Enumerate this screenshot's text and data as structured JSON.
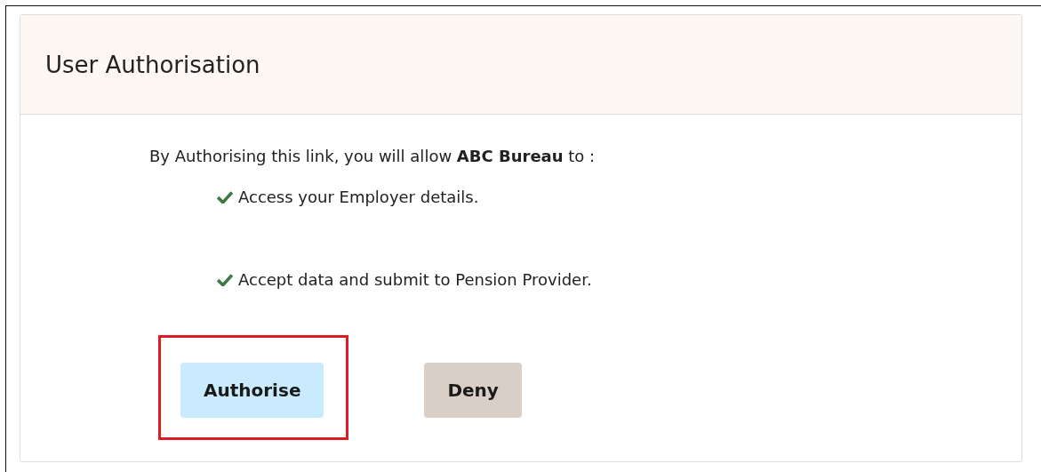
{
  "panel": {
    "title": "User Authorisation"
  },
  "intro": "By Authorising this link, you will allow **ABC Bureau** to :",
  "permissions": [
    {
      "text": "Access your Employer details."
    },
    {
      "text": "Accept data and submit to Pension Provider."
    }
  ],
  "buttons": [
    {
      "label": "Authorise",
      "kind": "primary",
      "highlighted": true
    },
    {
      "label": "Deny",
      "kind": "secondary",
      "highlighted": false
    }
  ]
}
